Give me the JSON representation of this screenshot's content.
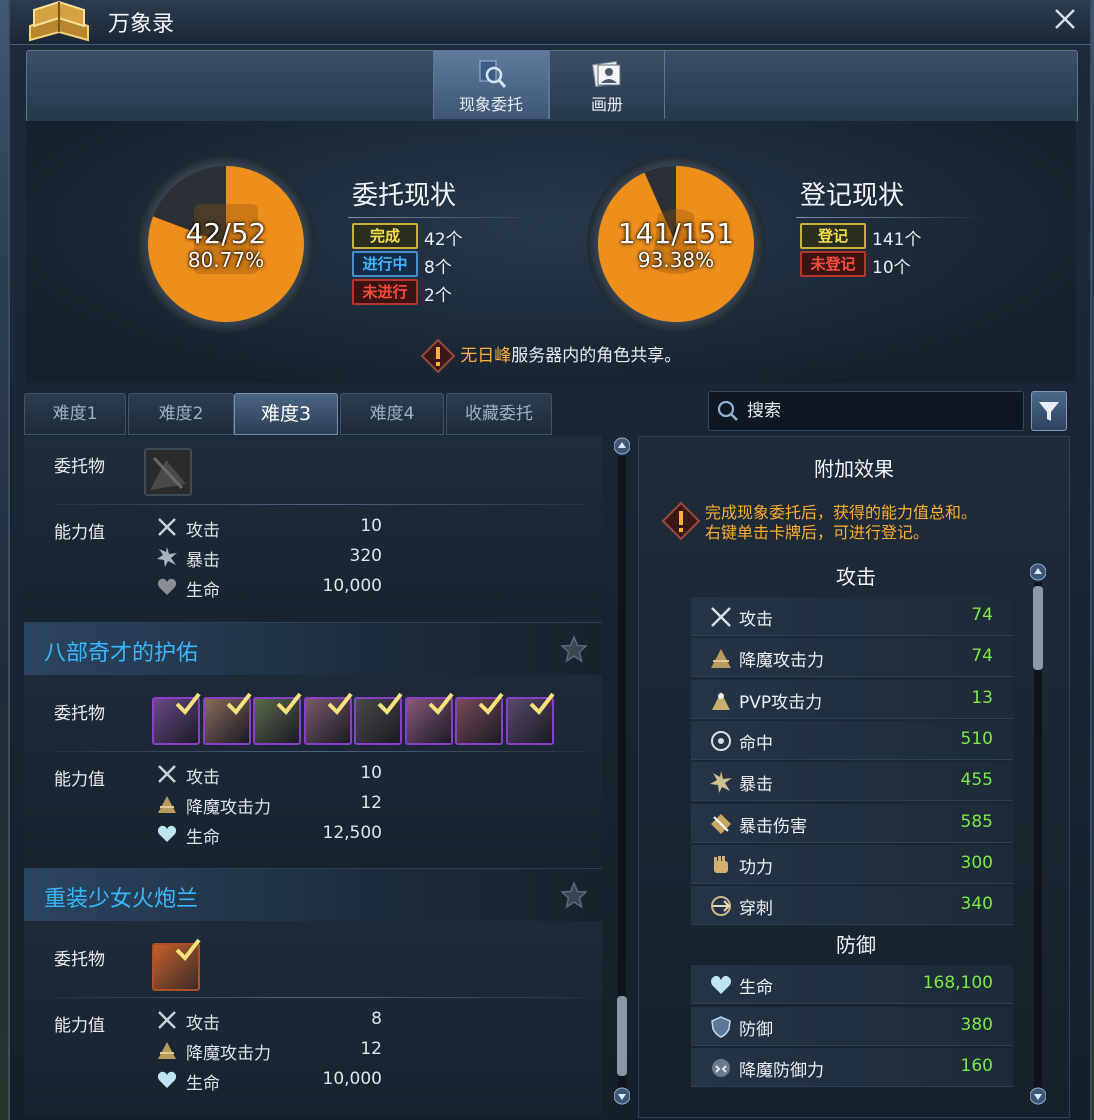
{
  "window": {
    "title": "万象录"
  },
  "top_tabs": [
    {
      "label": "现象委托",
      "active": true,
      "icon": "magnifier-icon"
    },
    {
      "label": "画册",
      "active": false,
      "icon": "album-icon"
    }
  ],
  "commission_status": {
    "title": "委托现状",
    "fraction": "42/52",
    "percent": "80.77%",
    "fill_ratio": 0.8077,
    "rows": [
      {
        "badge": "完成",
        "count": "42个"
      },
      {
        "badge": "进行中",
        "count": "8个"
      },
      {
        "badge": "未进行",
        "count": "2个"
      }
    ]
  },
  "register_status": {
    "title": "登记现状",
    "fraction": "141/151",
    "percent": "93.38%",
    "fill_ratio": 0.9338,
    "rows": [
      {
        "badge": "登记",
        "count": "141个"
      },
      {
        "badge": "未登记",
        "count": "10个"
      }
    ]
  },
  "notice": {
    "server": "无日峰",
    "text": "服务器内的角色共享。"
  },
  "difficulty_tabs": [
    "难度1",
    "难度2",
    "难度3",
    "难度4",
    "收藏委托"
  ],
  "active_difficulty": "难度3",
  "search": {
    "placeholder": "搜索",
    "value": ""
  },
  "labels": {
    "item": "委托物",
    "stats": "能力值"
  },
  "entries": [
    {
      "title": "",
      "stats": [
        {
          "icon": "sword-icon",
          "name": "攻击",
          "value": "10"
        },
        {
          "icon": "burst-icon",
          "name": "暴击",
          "value": "320"
        },
        {
          "icon": "heart-icon",
          "name": "生命",
          "value": "10,000"
        }
      ]
    },
    {
      "title": "八部奇才的护佑",
      "stats": [
        {
          "icon": "sword-icon",
          "name": "攻击",
          "value": "10"
        },
        {
          "icon": "demon-attack-icon",
          "name": "降魔攻击力",
          "value": "12"
        },
        {
          "icon": "heart-icon",
          "name": "生命",
          "value": "12,500"
        }
      ]
    },
    {
      "title": "重装少女火炮兰",
      "stats": [
        {
          "icon": "sword-icon",
          "name": "攻击",
          "value": "8"
        },
        {
          "icon": "demon-attack-icon",
          "name": "降魔攻击力",
          "value": "12"
        },
        {
          "icon": "heart-icon",
          "name": "生命",
          "value": "10,000"
        }
      ]
    }
  ],
  "bonus_panel": {
    "title": "附加效果",
    "note_line1": "完成现象委托后，获得的能力值总和。",
    "note_line2": "右键单击卡牌后，可进行登记。",
    "attack_header": "攻击",
    "attack_rows": [
      {
        "icon": "sword-icon",
        "name": "攻击",
        "value": "74"
      },
      {
        "icon": "demon-attack-icon",
        "name": "降魔攻击力",
        "value": "74"
      },
      {
        "icon": "pvp-attack-icon",
        "name": "PVP攻击力",
        "value": "13"
      },
      {
        "icon": "target-icon",
        "name": "命中",
        "value": "510"
      },
      {
        "icon": "burst-icon",
        "name": "暴击",
        "value": "455"
      },
      {
        "icon": "crit-damage-icon",
        "name": "暴击伤害",
        "value": "585"
      },
      {
        "icon": "fist-icon",
        "name": "功力",
        "value": "300"
      },
      {
        "icon": "pierce-icon",
        "name": "穿刺",
        "value": "340"
      }
    ],
    "defense_header": "防御",
    "defense_rows": [
      {
        "icon": "heart-icon",
        "name": "生命",
        "value": "168,100"
      },
      {
        "icon": "shield-icon",
        "name": "防御",
        "value": "380"
      },
      {
        "icon": "demon-defense-icon",
        "name": "降魔防御力",
        "value": "160"
      }
    ]
  },
  "colors": {
    "accent_orange": "#ee8f1c",
    "value_green": "#7bea48",
    "title_blue": "#38b8ff",
    "notice_orange": "#ffae2e"
  }
}
